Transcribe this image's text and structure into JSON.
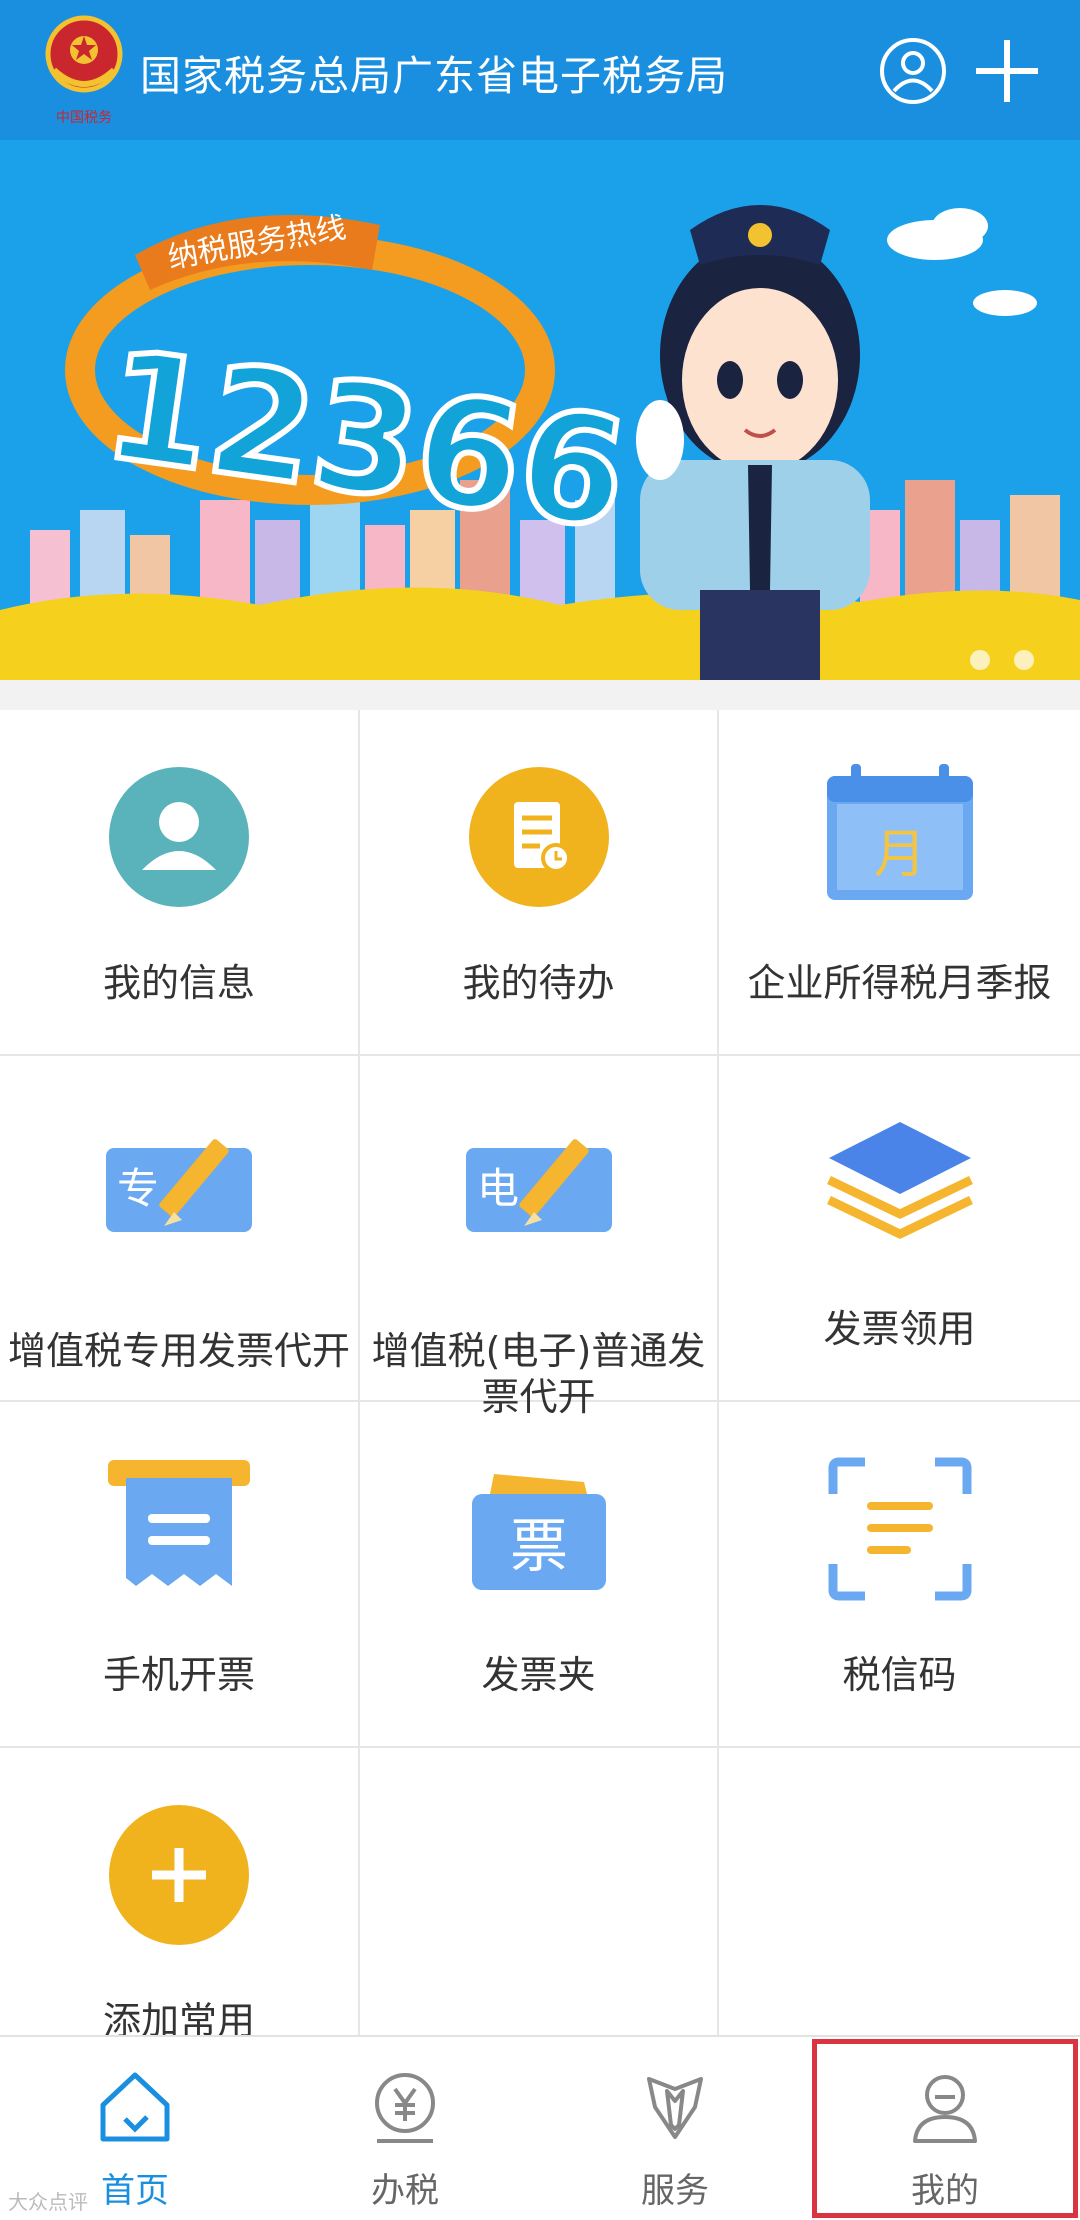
{
  "header": {
    "title": "国家税务总局广东省电子税务局",
    "emblem_caption": "中国税务",
    "user_icon": "user-circle-icon",
    "add_icon": "plus-icon",
    "background": "#1a8fe0"
  },
  "banner": {
    "ribbon_text": "纳税服务热线",
    "hotline": "12366"
  },
  "grid": {
    "items": [
      {
        "label": "我的信息",
        "icon": "my-info-icon"
      },
      {
        "label": "我的待办",
        "icon": "my-todo-icon"
      },
      {
        "label": "企业所得税月季报",
        "icon": "calendar-month-icon",
        "glyph": "月"
      },
      {
        "label": "增值税专用发票代开",
        "icon": "special-invoice-icon",
        "glyph": "专"
      },
      {
        "label": "增值税(电子)普通发票代开",
        "icon": "electronic-invoice-icon",
        "glyph": "电"
      },
      {
        "label": "发票领用",
        "icon": "layers-icon"
      },
      {
        "label": "手机开票",
        "icon": "mobile-invoice-icon"
      },
      {
        "label": "发票夹",
        "icon": "invoice-wallet-icon",
        "glyph": "票"
      },
      {
        "label": "税信码",
        "icon": "scan-code-icon"
      },
      {
        "label": "添加常用",
        "icon": "add-circle-icon"
      }
    ]
  },
  "bottom_nav": {
    "items": [
      {
        "label": "首页",
        "icon": "home-icon",
        "active": true
      },
      {
        "label": "办税",
        "icon": "tax-yen-icon",
        "active": false
      },
      {
        "label": "服务",
        "icon": "service-tie-icon",
        "active": false
      },
      {
        "label": "我的",
        "icon": "user-profile-icon",
        "active": false
      }
    ],
    "active_color": "#1a8fe0",
    "highlight_color": "#d9343f"
  },
  "watermark": "大众点评"
}
